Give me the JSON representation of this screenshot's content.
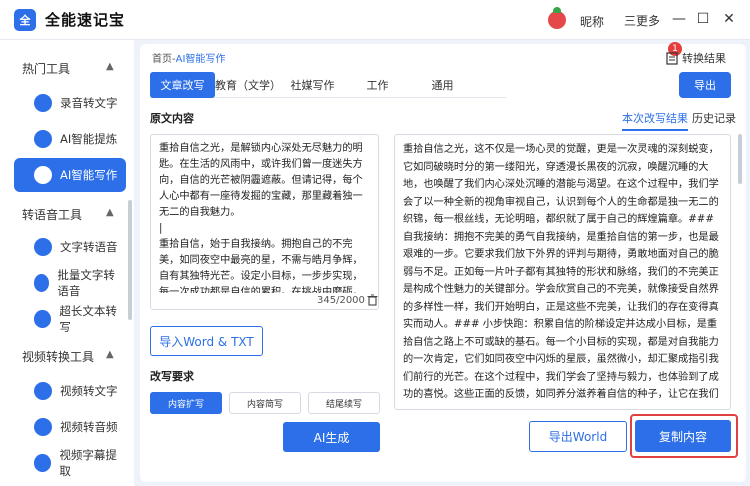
{
  "app": {
    "title": "全能速记宝",
    "logo_text": "全"
  },
  "header": {
    "nickname": "昵称",
    "more_label": "三更多",
    "minimize": "—",
    "maximize": "☐",
    "close": "✕"
  },
  "sidebar": {
    "groups": [
      {
        "label": "热门工具",
        "items": [
          {
            "label": "录音转文字",
            "icon": "record-icon"
          },
          {
            "label": "AI智能提炼",
            "icon": "ai-extract-icon"
          },
          {
            "label": "AI智能写作",
            "icon": "ai-write-icon",
            "active": true
          }
        ]
      },
      {
        "label": "转语音工具",
        "items": [
          {
            "label": "文字转语音",
            "icon": "text-to-speech-icon"
          },
          {
            "label": "批量文字转语音",
            "icon": "batch-tts-icon"
          },
          {
            "label": "超长文本转写",
            "icon": "long-text-icon"
          }
        ]
      },
      {
        "label": "视频转换工具",
        "items": [
          {
            "label": "视频转文字",
            "icon": "video-to-text-icon"
          },
          {
            "label": "视频转音频",
            "icon": "video-to-audio-icon"
          },
          {
            "label": "视频字幕提取",
            "icon": "subtitle-icon"
          }
        ]
      }
    ]
  },
  "breadcrumb": {
    "home": "首页",
    "sep": "-",
    "current": "AI智能写作"
  },
  "convert": {
    "label": "转换结果",
    "badge": "1"
  },
  "tabs": [
    "文章改写",
    "教育（文学）",
    "社媒写作",
    "工作",
    "通用"
  ],
  "export_label": "导出",
  "original": {
    "label": "原文内容",
    "text": "重拾自信之光，是解锁内心深处无尽魅力的明匙。在生活的风雨中，或许我们曾一度迷失方向，自信的光芒被阴霾遮蔽。但请记得，每个人心中都有一座待发掘的宝藏，那里藏着独一无二的自我魅力。\n|\n重拾自信，始于自我接纳。拥抱自己的不完美，如同夜空中最亮的星，不需与皓月争辉，自有其独特光芒。设定小目标，一步步实现，每一次成功都是自信的累积。在挑战中磨砺，在失败中成长，每一次尝试都在为自信的基石添砖加瓦。",
    "counter": "345/2000"
  },
  "import_label": "导入Word & TXT",
  "requirements": {
    "label": "改写要求",
    "options": [
      "内容扩写",
      "内容简写",
      "结尾续写"
    ]
  },
  "generate_label": "AI生成",
  "result": {
    "tabs": [
      "本次改写结果",
      "历史记录"
    ],
    "text": "重拾自信之光，这不仅是一场心灵的觉醒，更是一次灵魂的深刻蜕变，它如同破晓时分的第一缕阳光，穿透漫长黑夜的沉寂，唤醒沉睡的大地，也唤醒了我们内心深处沉睡的潜能与渴望。在这个过程中，我们学会了以一种全新的视角审视自己，认识到每个人的生命都是独一无二的织锦，每一根丝线，无论明暗，都织就了属于自己的辉煌篇章。### 自我接纳：拥抱不完美的勇气自我接纳，是重拾自信的第一步，也是最艰难的一步。它要求我们放下外界的评判与期待，勇敢地面对自己的脆弱与不足。正如每一片叶子都有其独特的形状和脉络，我们的不完美正是构成个性魅力的关键部分。学会欣赏自己的不完美，就像接受自然界的多样性一样，我们开始明白，正是这些不完美，让我们的存在变得真实而动人。### 小步快跑：积累自信的阶梯设定并达成小目标，是重拾自信之路上不可或缺的基石。每一个小目标的实现，都是对自我能力的一次肯定，它们如同夜空中闪烁的星辰，虽然微小，却汇聚成指引我们前行的光芒。在这个过程中，我们学会了坚持与毅力，也体验到了成功的喜悦。这些正面的反馈，如同养分滋养着自信的种子，让它在我们的心田生根发芽，茁壮成长。### 挑战与成长：铸就坚韧的内心面对挑战与失败，我们不再逃避或畏惧，而是"
  },
  "export_word_label": "导出World",
  "copy_label": "复制内容",
  "colors": {
    "accent": "#2c6fe8",
    "highlight": "#e04040"
  }
}
